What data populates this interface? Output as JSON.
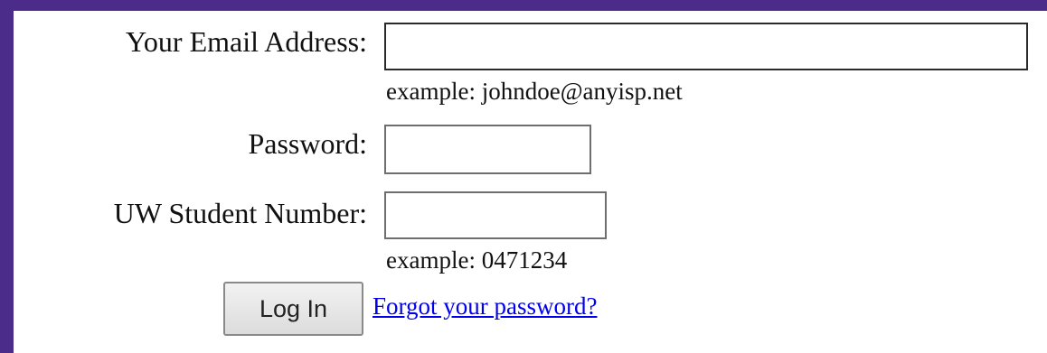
{
  "form": {
    "email": {
      "label": "Your Email Address:",
      "value": "",
      "hint": "example: johndoe@anyisp.net"
    },
    "password": {
      "label": "Password:",
      "value": ""
    },
    "student_number": {
      "label": "UW Student Number:",
      "value": "",
      "hint": "example: 0471234"
    },
    "login_button_label": "Log In",
    "forgot_link_label": "Forgot your password?"
  },
  "colors": {
    "frame": "#4b2c8a",
    "background": "#ffffff",
    "link": "#0000ee"
  }
}
